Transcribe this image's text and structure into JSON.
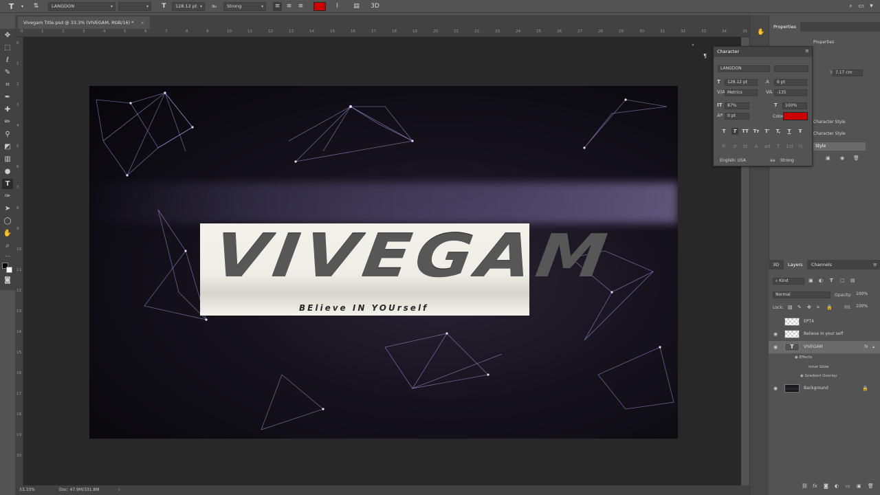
{
  "options_bar": {
    "font_family": "LANGDON",
    "font_size": "128.12 pt",
    "antialias": "Strong",
    "text_color": "#cc0000"
  },
  "document_tab": {
    "title": "Vivegam Title.psd @ 33.3% (VIVEGAM, RGB/16) *",
    "close": "×"
  },
  "ruler_top": [
    "0",
    "1",
    "2",
    "3",
    "4",
    "5",
    "6",
    "7",
    "8",
    "9",
    "10",
    "11",
    "12",
    "13",
    "14",
    "15",
    "16",
    "17",
    "18",
    "19",
    "20",
    "21",
    "22",
    "23",
    "24",
    "25",
    "26",
    "27",
    "28",
    "29",
    "30",
    "31",
    "32",
    "33",
    "34",
    "35"
  ],
  "ruler_left": [
    "0",
    "1",
    "2",
    "3",
    "4",
    "5",
    "6",
    "7",
    "8",
    "9",
    "10",
    "11",
    "12",
    "13",
    "14",
    "15",
    "16",
    "17",
    "18",
    "19",
    "20"
  ],
  "canvas": {
    "title": "VIVEGAM",
    "subtitle": "BElieve IN YOUrself"
  },
  "status_bar": {
    "zoom": "33.33%",
    "doc_size": "Doc: 47.9M/331.8M"
  },
  "properties_panel": {
    "title": "Properties",
    "sub_title": "Properties",
    "y_value": "7.17 cm"
  },
  "character_panel": {
    "title": "Character",
    "font_family": "LANGDON",
    "font_size": "128.12 pt",
    "leading": "6 pt",
    "kerning": "Metrics",
    "tracking": "-135",
    "vertical_scale": "87%",
    "horizontal_scale": "100%",
    "baseline_shift": "0 pt",
    "color_label": "Color:",
    "color": "#cc0000",
    "language": "English: USA",
    "antialias": "Strong",
    "style_buttons": [
      "T",
      "T",
      "TT",
      "Tт",
      "T'",
      "T,",
      "T",
      "Ŧ"
    ]
  },
  "character_styles": {
    "items": [
      "Character Style",
      "Character Style",
      "Style"
    ]
  },
  "layers_panel": {
    "tabs": [
      "3D",
      "Layers",
      "Channels"
    ],
    "filter": "Kind",
    "blend_mode": "Normal",
    "opacity_label": "Opacity:",
    "opacity": "100%",
    "lock_label": "Lock:",
    "fill_label": "Fill:",
    "fill": "100%",
    "layers": [
      {
        "name": "EPT4",
        "visible": false
      },
      {
        "name": "Believe in your self",
        "visible": true
      },
      {
        "name": "VIVEGAM",
        "visible": true
      },
      {
        "name": "Background",
        "visible": true
      }
    ],
    "effects_label": "Effects",
    "effects": [
      "Inner Glow",
      "Gradient Overlay"
    ],
    "fx": "fx"
  }
}
